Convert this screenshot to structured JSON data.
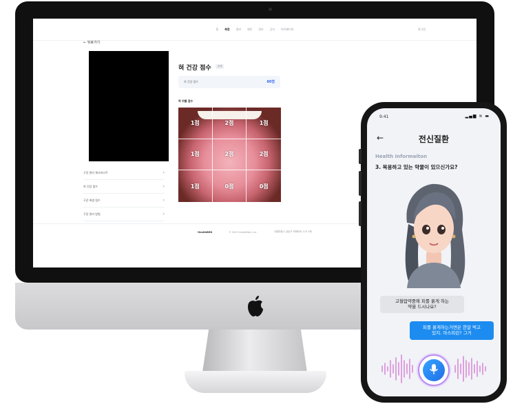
{
  "imac": {
    "nav": [
      "홈",
      "측정",
      "결과",
      "제안",
      "정보",
      "공지",
      "마이페이지"
    ],
    "nav_active_index": 1,
    "login": "로그인",
    "back": "← 뒤로가기",
    "menu": [
      "구강 관리 체크리스트",
      "혀 건강 점수",
      "구강 위생 점수",
      "구강 관리 방법"
    ],
    "score_title": "혀 건강 점수",
    "score_badge": "상세",
    "score_label": "혀 건강 점수",
    "score_value": "80점",
    "zone_title": "혀 위별 점수",
    "tongue_scores": [
      "1점",
      "2점",
      "1점",
      "1점",
      "2점",
      "2점",
      "1점",
      "0점",
      "0점"
    ],
    "footer": [
      "HealthBEN",
      "© 2023 HealthBen, Inc.",
      "서울특별시 강남구 테헤란로 123 4층"
    ]
  },
  "phone": {
    "time": "9:41",
    "status_icons": "▂▄▆ ≋ ▬",
    "back": "←",
    "title": "전신질환",
    "health_label": "Health Informaiton",
    "question": "3. 복용하고 있는 약물이 있으신가요?",
    "bubble_left_1": "고혈압약중에 피를 묽게 하는",
    "bubble_left_2": "약을 드시나요?",
    "bubble_right_1": "피를 묽게하는거면은 한알 먹고",
    "bubble_right_2": "있지. 아스피린? 그거",
    "mic_icon": "mic-icon",
    "colors": {
      "accent": "#1d8cf0",
      "mic_ring": "#b98cf0",
      "wave": "#d98ad8"
    }
  }
}
